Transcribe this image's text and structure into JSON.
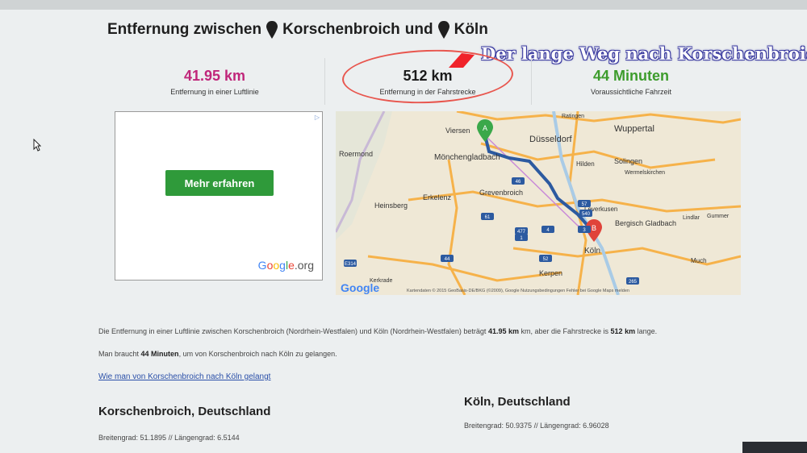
{
  "page": {
    "title_part1": "Entfernung zwischen",
    "origin": "Korschenbroich",
    "title_part2": "und",
    "destination": "Köln"
  },
  "overlay_caption": "Der lange Weg nach Korschenbroich",
  "stats": {
    "air": {
      "value": "41.95 km",
      "label": "Entfernung in einer Luftlinie"
    },
    "road": {
      "value": "512 km",
      "label": "Entfernung in der Fahrstrecke"
    },
    "time": {
      "value": "44 Minuten",
      "label": "Voraussichtliche Fahrzeit"
    }
  },
  "ad": {
    "button_label": "Mehr erfahren",
    "logo_text": "Google.org",
    "corner_badge": "▷"
  },
  "map": {
    "cities": {
      "viersen": "Viersen",
      "duesseldorf": "Düsseldorf",
      "wuppertal": "Wuppertal",
      "roermond": "Roermond",
      "moenchengladbach": "Mönchengladbach",
      "hilden": "Hilden",
      "solingen": "Solingen",
      "wermelskirchen": "Wermelskirchen",
      "erkelenz": "Erkelenz",
      "grevenbroich": "Grevenbroich",
      "heinsberg": "Heinsberg",
      "leverkusen": "Leverkusen",
      "bergisch_gladbach": "Bergisch\nGladbach",
      "koeln": "Köln",
      "kerpen": "Kerpen",
      "ratingen": "Ratingen",
      "lindlar": "Lindlar",
      "gummersbach": "Gummer",
      "much": "Much",
      "kerkrade": "Kerkrade"
    },
    "marker_a": "A",
    "marker_b": "B",
    "logo": "Google",
    "attribution": "Kartendaten © 2015 GeoBasis-DE/BKG (©2009), Google   Nutzungsbedingungen   Fehler bei Google Maps melden",
    "road_labels": [
      "46",
      "61",
      "57",
      "44",
      "4",
      "1",
      "3",
      "540",
      "52",
      "477",
      "265",
      "E314"
    ]
  },
  "description": {
    "line1_pre": "Die Entfernung in einer Luftlinie zwischen Korschenbroich (Nordrhein-Westfalen) und Köln (Nordrhein-Westfalen) beträgt",
    "line1_air": "41.95 km",
    "line1_mid": "km, aber die Fahrstrecke is",
    "line1_road": "512 km",
    "line1_post": "lange.",
    "line2_pre": "Man braucht",
    "line2_time": "44 Minuten",
    "line2_post": ", um von Korschenbroich nach Köln zu gelangen.",
    "link": "Wie man von Korschenbroich nach Köln gelangt"
  },
  "origin_info": {
    "heading": "Korschenbroich, Deutschland",
    "coords": "Breitengrad: 51.1895 // Längengrad: 6.5144"
  },
  "destination_info": {
    "heading": "Köln, Deutschland",
    "coords": "Breitengrad: 50.9375 // Längengrad: 6.96028"
  },
  "colors": {
    "air": "#c0267a",
    "time": "#3d9c2c",
    "route": "#2c5aa0",
    "button": "#2f9a3a"
  }
}
